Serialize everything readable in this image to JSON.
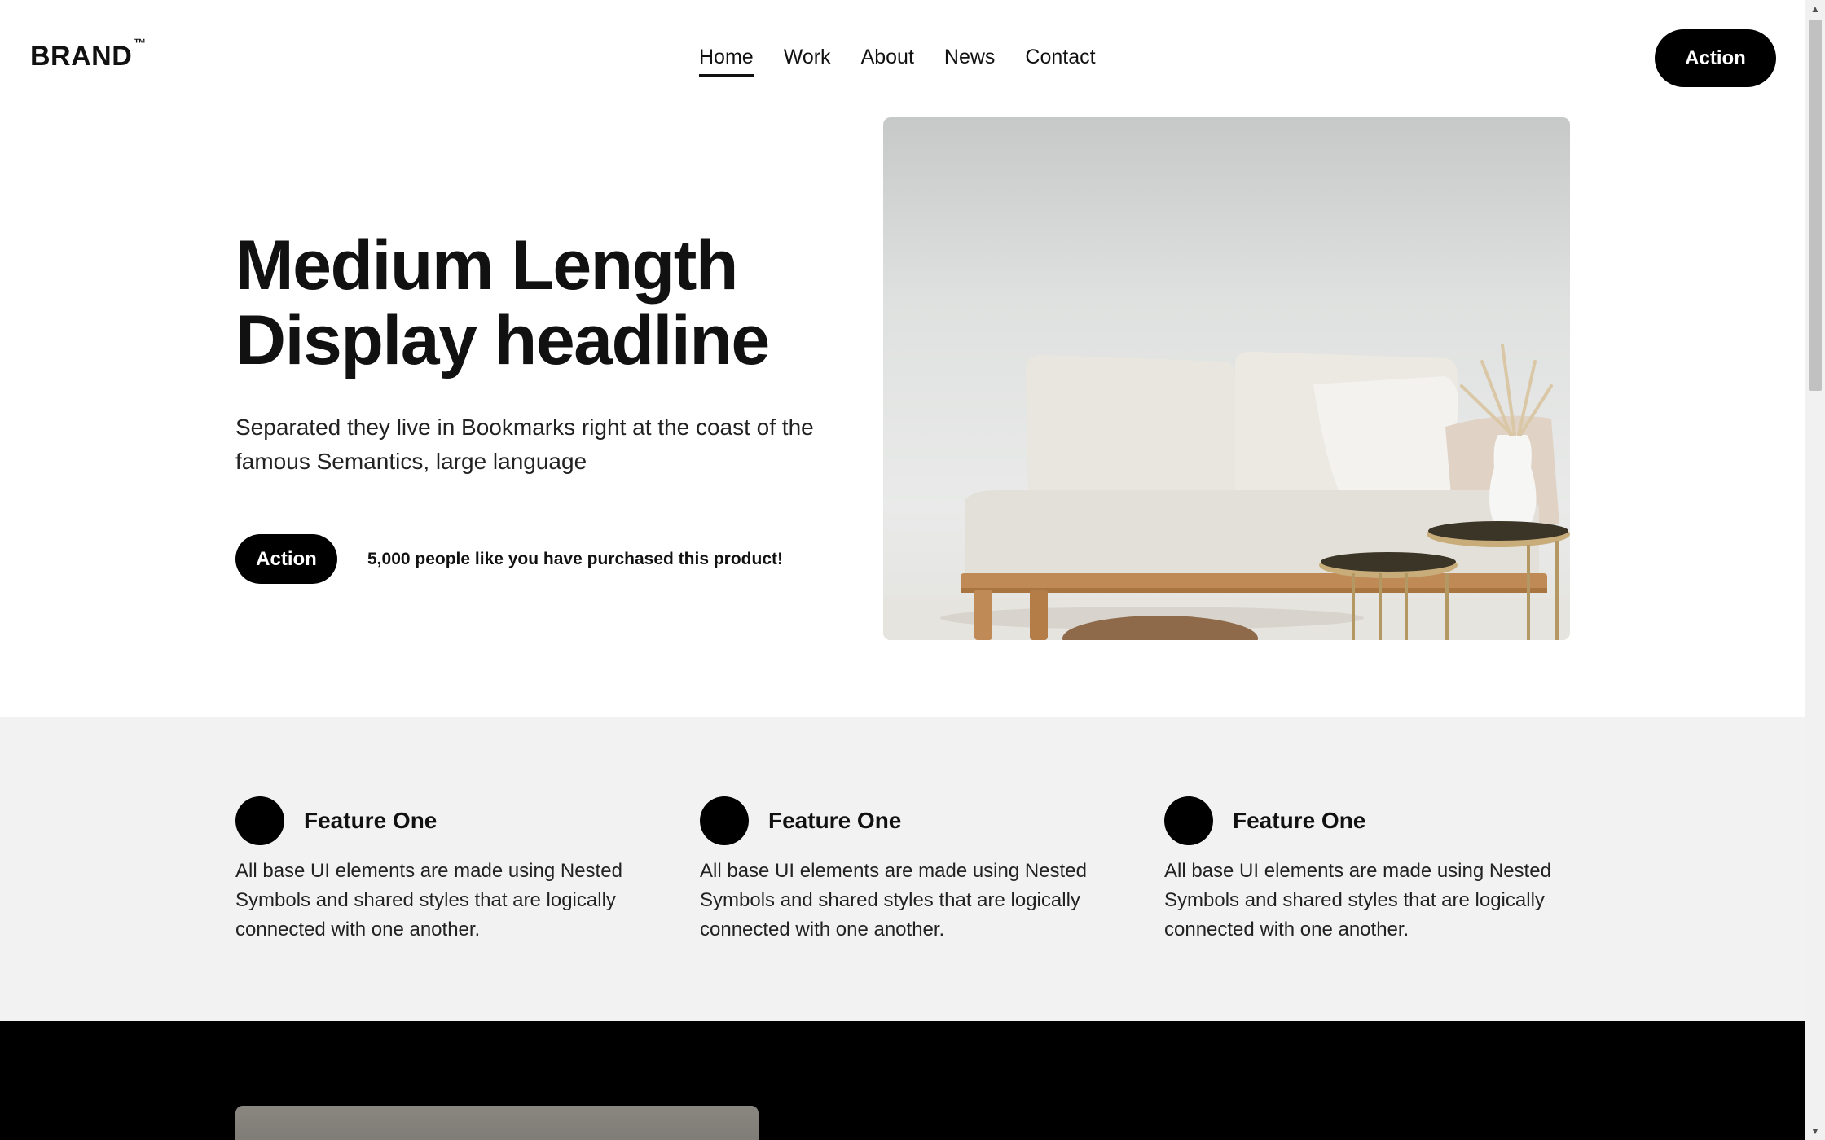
{
  "header": {
    "brand": "BRAND",
    "brand_mark": "™",
    "nav": [
      {
        "label": "Home",
        "active": true
      },
      {
        "label": "Work",
        "active": false
      },
      {
        "label": "About",
        "active": false
      },
      {
        "label": "News",
        "active": false
      },
      {
        "label": "Contact",
        "active": false
      }
    ],
    "action_label": "Action"
  },
  "hero": {
    "headline_line1": "Medium Length",
    "headline_line2": "Display headline",
    "subhead": "Separated they live in Bookmarks right at the coast of the famous Semantics, large language",
    "cta_label": "Action",
    "social_proof": "5,000 people like you have purchased this product!"
  },
  "features": [
    {
      "title": "Feature One",
      "description": "All base UI elements are made using Nested Symbols and shared styles that are logically connected with one another."
    },
    {
      "title": "Feature One",
      "description": "All base UI elements are made using Nested Symbols and shared styles that are logically connected with one another."
    },
    {
      "title": "Feature One",
      "description": "All base UI elements are made using Nested Symbols and shared styles that are logically connected with one another."
    }
  ],
  "scrollbar": {
    "up_icon": "▲",
    "down_icon": "▼"
  },
  "colors": {
    "primary": "#000000",
    "features_bg": "#f2f2f2",
    "text": "#111111"
  }
}
